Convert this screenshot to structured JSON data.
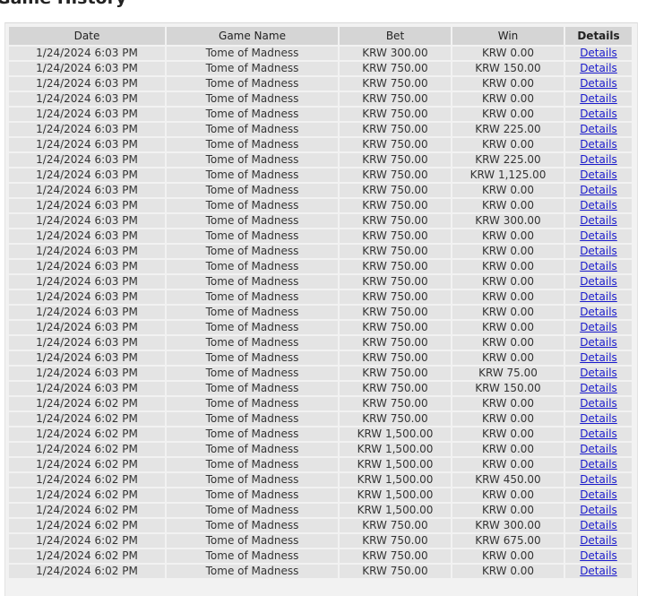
{
  "page": {
    "title": "Game History"
  },
  "table": {
    "headers": {
      "date": "Date",
      "game": "Game Name",
      "bet": "Bet",
      "win": "Win",
      "details": "Details"
    },
    "rows": [
      {
        "date": "1/24/2024 6:03 PM",
        "game": "Tome of Madness",
        "bet": "KRW 300.00",
        "win": "KRW 0.00",
        "details": "Details"
      },
      {
        "date": "1/24/2024 6:03 PM",
        "game": "Tome of Madness",
        "bet": "KRW 750.00",
        "win": "KRW 150.00",
        "details": "Details"
      },
      {
        "date": "1/24/2024 6:03 PM",
        "game": "Tome of Madness",
        "bet": "KRW 750.00",
        "win": "KRW 0.00",
        "details": "Details"
      },
      {
        "date": "1/24/2024 6:03 PM",
        "game": "Tome of Madness",
        "bet": "KRW 750.00",
        "win": "KRW 0.00",
        "details": "Details"
      },
      {
        "date": "1/24/2024 6:03 PM",
        "game": "Tome of Madness",
        "bet": "KRW 750.00",
        "win": "KRW 0.00",
        "details": "Details"
      },
      {
        "date": "1/24/2024 6:03 PM",
        "game": "Tome of Madness",
        "bet": "KRW 750.00",
        "win": "KRW 225.00",
        "details": "Details"
      },
      {
        "date": "1/24/2024 6:03 PM",
        "game": "Tome of Madness",
        "bet": "KRW 750.00",
        "win": "KRW 0.00",
        "details": "Details"
      },
      {
        "date": "1/24/2024 6:03 PM",
        "game": "Tome of Madness",
        "bet": "KRW 750.00",
        "win": "KRW 225.00",
        "details": "Details"
      },
      {
        "date": "1/24/2024 6:03 PM",
        "game": "Tome of Madness",
        "bet": "KRW 750.00",
        "win": "KRW 1,125.00",
        "details": "Details"
      },
      {
        "date": "1/24/2024 6:03 PM",
        "game": "Tome of Madness",
        "bet": "KRW 750.00",
        "win": "KRW 0.00",
        "details": "Details"
      },
      {
        "date": "1/24/2024 6:03 PM",
        "game": "Tome of Madness",
        "bet": "KRW 750.00",
        "win": "KRW 0.00",
        "details": "Details"
      },
      {
        "date": "1/24/2024 6:03 PM",
        "game": "Tome of Madness",
        "bet": "KRW 750.00",
        "win": "KRW 300.00",
        "details": "Details"
      },
      {
        "date": "1/24/2024 6:03 PM",
        "game": "Tome of Madness",
        "bet": "KRW 750.00",
        "win": "KRW 0.00",
        "details": "Details"
      },
      {
        "date": "1/24/2024 6:03 PM",
        "game": "Tome of Madness",
        "bet": "KRW 750.00",
        "win": "KRW 0.00",
        "details": "Details"
      },
      {
        "date": "1/24/2024 6:03 PM",
        "game": "Tome of Madness",
        "bet": "KRW 750.00",
        "win": "KRW 0.00",
        "details": "Details"
      },
      {
        "date": "1/24/2024 6:03 PM",
        "game": "Tome of Madness",
        "bet": "KRW 750.00",
        "win": "KRW 0.00",
        "details": "Details"
      },
      {
        "date": "1/24/2024 6:03 PM",
        "game": "Tome of Madness",
        "bet": "KRW 750.00",
        "win": "KRW 0.00",
        "details": "Details"
      },
      {
        "date": "1/24/2024 6:03 PM",
        "game": "Tome of Madness",
        "bet": "KRW 750.00",
        "win": "KRW 0.00",
        "details": "Details"
      },
      {
        "date": "1/24/2024 6:03 PM",
        "game": "Tome of Madness",
        "bet": "KRW 750.00",
        "win": "KRW 0.00",
        "details": "Details"
      },
      {
        "date": "1/24/2024 6:03 PM",
        "game": "Tome of Madness",
        "bet": "KRW 750.00",
        "win": "KRW 0.00",
        "details": "Details"
      },
      {
        "date": "1/24/2024 6:03 PM",
        "game": "Tome of Madness",
        "bet": "KRW 750.00",
        "win": "KRW 0.00",
        "details": "Details"
      },
      {
        "date": "1/24/2024 6:03 PM",
        "game": "Tome of Madness",
        "bet": "KRW 750.00",
        "win": "KRW 75.00",
        "details": "Details"
      },
      {
        "date": "1/24/2024 6:03 PM",
        "game": "Tome of Madness",
        "bet": "KRW 750.00",
        "win": "KRW 150.00",
        "details": "Details"
      },
      {
        "date": "1/24/2024 6:02 PM",
        "game": "Tome of Madness",
        "bet": "KRW 750.00",
        "win": "KRW 0.00",
        "details": "Details"
      },
      {
        "date": "1/24/2024 6:02 PM",
        "game": "Tome of Madness",
        "bet": "KRW 750.00",
        "win": "KRW 0.00",
        "details": "Details"
      },
      {
        "date": "1/24/2024 6:02 PM",
        "game": "Tome of Madness",
        "bet": "KRW 1,500.00",
        "win": "KRW 0.00",
        "details": "Details"
      },
      {
        "date": "1/24/2024 6:02 PM",
        "game": "Tome of Madness",
        "bet": "KRW 1,500.00",
        "win": "KRW 0.00",
        "details": "Details"
      },
      {
        "date": "1/24/2024 6:02 PM",
        "game": "Tome of Madness",
        "bet": "KRW 1,500.00",
        "win": "KRW 0.00",
        "details": "Details"
      },
      {
        "date": "1/24/2024 6:02 PM",
        "game": "Tome of Madness",
        "bet": "KRW 1,500.00",
        "win": "KRW 450.00",
        "details": "Details"
      },
      {
        "date": "1/24/2024 6:02 PM",
        "game": "Tome of Madness",
        "bet": "KRW 1,500.00",
        "win": "KRW 0.00",
        "details": "Details"
      },
      {
        "date": "1/24/2024 6:02 PM",
        "game": "Tome of Madness",
        "bet": "KRW 1,500.00",
        "win": "KRW 0.00",
        "details": "Details"
      },
      {
        "date": "1/24/2024 6:02 PM",
        "game": "Tome of Madness",
        "bet": "KRW 750.00",
        "win": "KRW 300.00",
        "details": "Details"
      },
      {
        "date": "1/24/2024 6:02 PM",
        "game": "Tome of Madness",
        "bet": "KRW 750.00",
        "win": "KRW 675.00",
        "details": "Details"
      },
      {
        "date": "1/24/2024 6:02 PM",
        "game": "Tome of Madness",
        "bet": "KRW 750.00",
        "win": "KRW 0.00",
        "details": "Details"
      },
      {
        "date": "1/24/2024 6:02 PM",
        "game": "Tome of Madness",
        "bet": "KRW 750.00",
        "win": "KRW 0.00",
        "details": "Details"
      }
    ]
  },
  "colors": {
    "header_bg": "#d5d5d5",
    "cell_bg": "#e4e4e4",
    "table_bg": "#f2f2f2",
    "link": "#1a1acc"
  }
}
